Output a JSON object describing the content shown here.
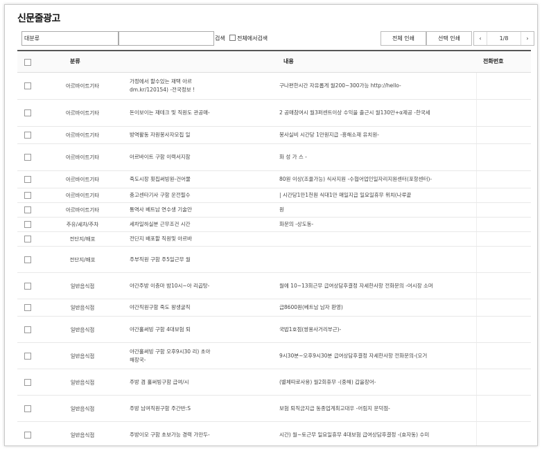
{
  "page": {
    "title": "신문줄광고"
  },
  "toolbar": {
    "category_select": "대분류",
    "search_value": "",
    "search_button": "검색",
    "search_within_label": "전체에서검색",
    "print_all": "전체 인쇄",
    "print_selected": "선택 인쇄",
    "pager": {
      "prev": "‹",
      "page": "1/8",
      "next": "›"
    }
  },
  "table": {
    "headers": {
      "category": "분류",
      "content": "내용",
      "phone": "전화번호"
    },
    "rows": [
      {
        "category": "아르바이트기타",
        "left": "가정에서 할수있는 재택 아르 dm.kr/120154) -전국정보 !",
        "right": "구나편한시간 자유롭게 월200~300가능 http://hello-"
      },
      {
        "category": "아르바이트기타",
        "left": "돈이보이는 재테크 및 직원도 관공매-",
        "right": "2 공매참여시 월3퍼센트이상 수익을 출근시 월130만+α제공 -한국세"
      },
      {
        "category": "아르바이트기타",
        "left": "방역활동 자원봉사자모집 일",
        "right": "봉사실비 시간당 1만원지급 -흥해소재 유치원-"
      },
      {
        "category": "아르바이트기타",
        "left": "아르바이트 구함 이력서지참",
        "right": "화 성 가 스 -"
      },
      {
        "category": "아르바이트기타",
        "left": "죽도시장 횟집써빙원-건어물",
        "right": "80원 이상(조율가능) 식사지원 -수협어업인일자리지원센터(포항센터)-"
      },
      {
        "category": "아르바이트기타",
        "left": "충고센타기사 구함 운전필수",
        "right": "| 시간당1만1천원 식대1만 매일지급 일요일휴무 위치(나루끝"
      },
      {
        "category": "아르바이트기타",
        "left": "통역사 베트남 연수생 기술안",
        "right": "원"
      },
      {
        "category": "주유/세차/주차",
        "left": "세차일하실분 근무조건 시간",
        "right": "화문의 -상도동-"
      },
      {
        "category": "전단지/배포",
        "left": "전단지 배포할 직원및 아르바",
        "right": ""
      },
      {
        "category": "전단지/배포",
        "left": "주부직원 구함 주5일근무 월",
        "right": ""
      },
      {
        "category": "일반음식점",
        "left": "야간주방 이층마 밤10시~아 리곱탕-",
        "right": "월에 10~13회근무 급여상담후결정 자세한사항 전화문의 -어시장 소머"
      },
      {
        "category": "일반음식점",
        "left": "야간직원구함 죽도 왕생굴직",
        "right": "급8600원(베트남 남자 환영)"
      },
      {
        "category": "일반음식점",
        "left": "야간홀써빙 구함 4대보험 퇴",
        "right": "국밥1호점(쌍용사거리부근)-"
      },
      {
        "category": "일반음식점",
        "left": "야간홀써빙 구함 오후9시30 리) 초아해장국-",
        "right": "9시30분~오후9시30분 급여상담후결정 자세한사항 전화문의-(오거"
      },
      {
        "category": "일반음식점",
        "left": "주방 겸 홀써빙구함 급여/시",
        "right": "(별체따로사용) 월2회휴무 -(중해) 갑을장어-"
      },
      {
        "category": "일반음식점",
        "left": "주방 남여직원구함 주간반:S",
        "right": "보험 퇴직금지급 동종업계최고대우 -어림지 문덕점-"
      },
      {
        "category": "일반음식점",
        "left": "주방이모 구함 초보가능 경력 가만두-",
        "right": "시간) 월~토근무 일요일휴무 4대보험 급여상담후결정 -(효자동) 수미"
      }
    ]
  }
}
